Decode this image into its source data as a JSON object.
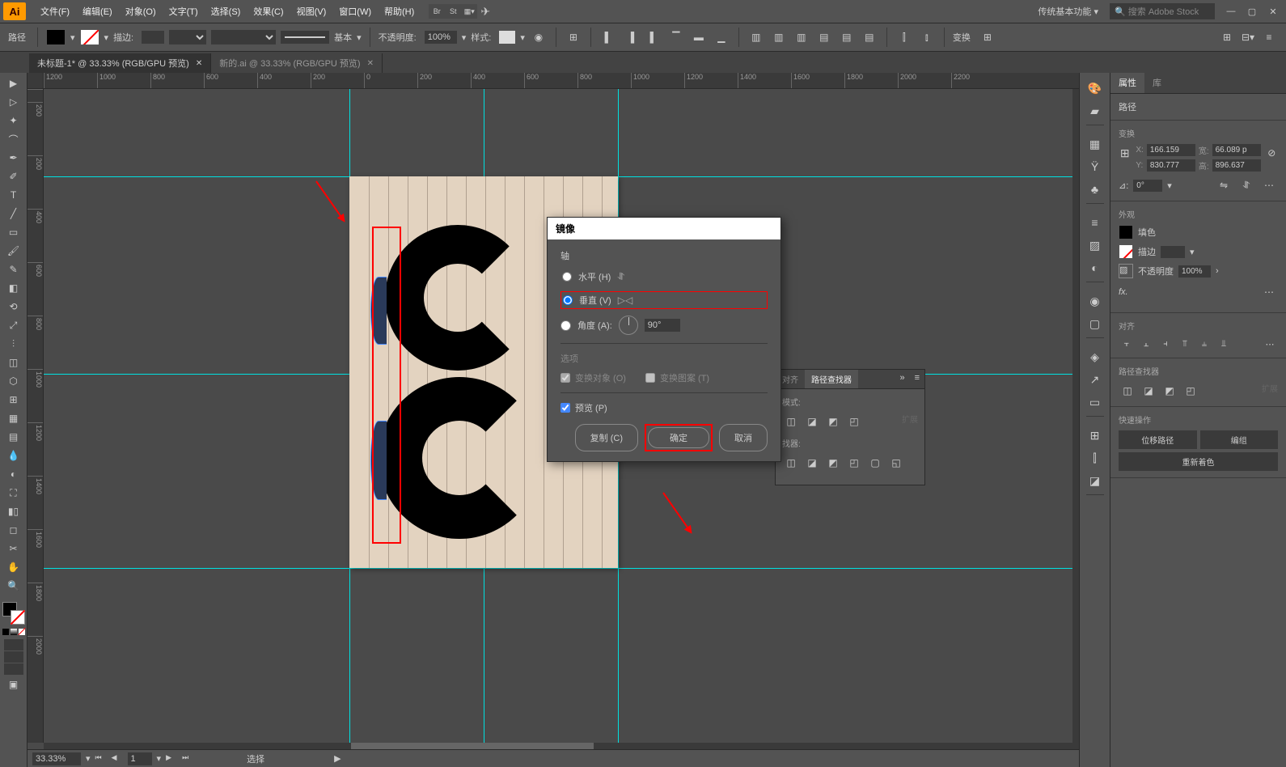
{
  "app": {
    "icon": "Ai"
  },
  "menubar": {
    "items": [
      "文件(F)",
      "编辑(E)",
      "对象(O)",
      "文字(T)",
      "选择(S)",
      "效果(C)",
      "视图(V)",
      "窗口(W)",
      "帮助(H)"
    ],
    "workspace": "传统基本功能",
    "search_placeholder": "搜索 Adobe Stock"
  },
  "controlbar": {
    "object_type": "路径",
    "stroke_label": "描边:",
    "stroke_width": "",
    "stroke_style": "基本",
    "opacity_label": "不透明度:",
    "opacity_value": "100%",
    "style_label": "样式:",
    "transform_label": "变换"
  },
  "tabs": [
    {
      "label": "未标题-1* @ 33.33% (RGB/GPU 预览)",
      "active": true
    },
    {
      "label": "新的.ai @ 33.33% (RGB/GPU 预览)",
      "active": false
    }
  ],
  "ruler_h": [
    "1200",
    "1000",
    "800",
    "600",
    "400",
    "200",
    "0",
    "200",
    "400",
    "600",
    "800",
    "1000",
    "1200",
    "1400",
    "1600",
    "1800",
    "2000",
    "2200"
  ],
  "ruler_v": [
    "200",
    "200",
    "400",
    "600",
    "800",
    "1000",
    "1200",
    "1400",
    "1600",
    "1800",
    "2000"
  ],
  "statusbar": {
    "zoom": "33.33%",
    "artboard": "1",
    "mode": "选择"
  },
  "properties": {
    "tabs": [
      "属性",
      "库"
    ],
    "object_type": "路径",
    "transform_section": "变换",
    "x_label": "X:",
    "x_value": "166.159",
    "y_label": "Y:",
    "y_value": "830.777",
    "w_label": "宽:",
    "w_value": "66.089 p",
    "h_label": "高:",
    "h_value": "896.637",
    "rotate_label": "⊿:",
    "rotate_value": "0°",
    "appearance_section": "外观",
    "fill_label": "填色",
    "stroke_label": "描边",
    "stroke_width": "",
    "opacity_label": "不透明度",
    "opacity_value": "100%",
    "fx_label": "fx.",
    "align_section": "对齐",
    "pathfinder_section": "路径查找器",
    "expand_label": "扩展",
    "quick_section": "快速操作",
    "quick_buttons": [
      "位移路径",
      "编组",
      "重新着色"
    ]
  },
  "float_panel": {
    "tabs": [
      "对齐",
      "路径查找器"
    ],
    "modes_label": "模式:",
    "finders_label": "找器:",
    "expand": "扩展"
  },
  "modal": {
    "title": "镜像",
    "axis_label": "轴",
    "horizontal": "水平 (H)",
    "vertical": "垂直 (V)",
    "angle_label": "角度 (A):",
    "angle_value": "90°",
    "options_label": "选项",
    "transform_objects": "变换对象 (O)",
    "transform_patterns": "变换图案 (T)",
    "preview": "预览 (P)",
    "copy_btn": "复制 (C)",
    "ok_btn": "确定",
    "cancel_btn": "取消"
  }
}
